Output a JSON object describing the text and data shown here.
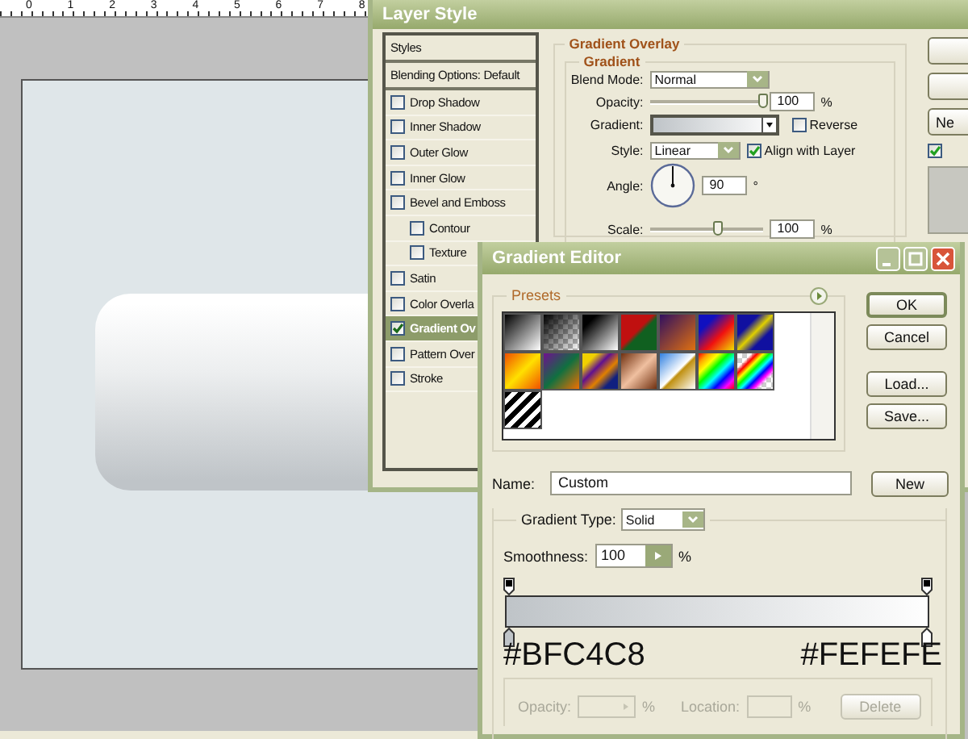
{
  "ruler": {
    "labels": [
      "0",
      "1",
      "2",
      "3",
      "4",
      "5",
      "6",
      "7",
      "8"
    ]
  },
  "layer_style": {
    "title": "Layer Style",
    "styles_list": [
      {
        "label": "Styles",
        "kind": "header",
        "selected": false
      },
      {
        "label": "Blending Options: Default",
        "kind": "header",
        "selected": false
      },
      {
        "label": "Drop Shadow",
        "kind": "effect",
        "checked": false,
        "selected": false
      },
      {
        "label": "Inner Shadow",
        "kind": "effect",
        "checked": false,
        "selected": false
      },
      {
        "label": "Outer Glow",
        "kind": "effect",
        "checked": false,
        "selected": false
      },
      {
        "label": "Inner Glow",
        "kind": "effect",
        "checked": false,
        "selected": false
      },
      {
        "label": "Bevel and Emboss",
        "kind": "effect",
        "checked": false,
        "selected": false,
        "children": [
          {
            "label": "Contour",
            "kind": "effect",
            "checked": false,
            "selected": false
          },
          {
            "label": "Texture",
            "kind": "effect",
            "checked": false,
            "selected": false
          }
        ]
      },
      {
        "label": "Satin",
        "kind": "effect",
        "checked": false,
        "selected": false
      },
      {
        "label": "Color Overla",
        "kind": "effect",
        "checked": false,
        "selected": false
      },
      {
        "label": "Gradient Ov",
        "kind": "effect",
        "checked": true,
        "selected": true
      },
      {
        "label": "Pattern Over",
        "kind": "effect",
        "checked": false,
        "selected": false
      },
      {
        "label": "Stroke",
        "kind": "effect",
        "checked": false,
        "selected": false
      }
    ],
    "gradient_overlay": {
      "title": "Gradient Overlay",
      "subtitle": "Gradient",
      "blend_mode": {
        "label": "Blend Mode:",
        "value": "Normal"
      },
      "opacity": {
        "label": "Opacity:",
        "level": 1,
        "value": "100",
        "unit": "%"
      },
      "gradient": {
        "label": "Gradient:"
      },
      "reverse": {
        "label": "Reverse",
        "checked": false
      },
      "style": {
        "label": "Style:",
        "value": "Linear"
      },
      "align_with_layer": {
        "label": "Align with Layer",
        "checked": true
      },
      "angle": {
        "label": "Angle:",
        "value": "90",
        "unit": "°"
      },
      "scale": {
        "label": "Scale:",
        "level": 0.61,
        "value": "100",
        "unit": "%"
      }
    },
    "side_panel": {
      "new_button": "Ne",
      "preview": {
        "checked": true
      }
    }
  },
  "gradient_editor": {
    "title": "Gradient Editor",
    "presets_label": "Presets",
    "buttons": [
      "OK",
      "Cancel",
      "Load...",
      "Save..."
    ],
    "name": {
      "label": "Name:",
      "value": "Custom"
    },
    "new_button": "New",
    "gradient_type": {
      "label": "Gradient Type:",
      "value": "Solid"
    },
    "smoothness": {
      "label": "Smoothness:",
      "value": "100",
      "unit": "%"
    },
    "stops": [
      {
        "color": "#bfc4c8",
        "label": "#BFC4C8"
      },
      {
        "color": "#fefefe",
        "label": "#FEFEFE"
      }
    ],
    "opacity": {
      "label": "Opacity:",
      "unit": "%",
      "disabled": true
    },
    "location": {
      "label": "Location:",
      "unit": "%",
      "disabled": true
    },
    "delete_button": {
      "label": "Delete",
      "disabled": true
    }
  }
}
